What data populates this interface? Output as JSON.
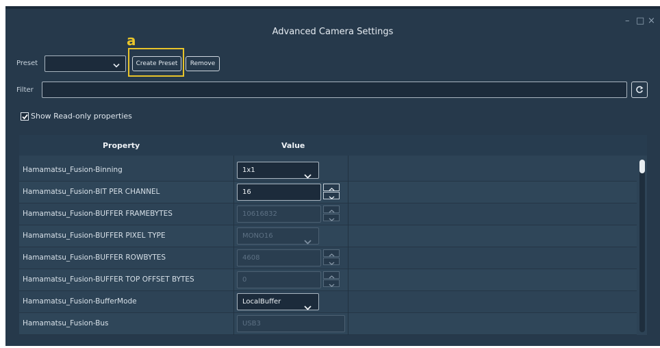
{
  "window": {
    "title": "Advanced Camera Settings",
    "controls": {
      "minimize": "–",
      "maximize": "□",
      "close": "×"
    }
  },
  "annotation": {
    "letter": "a",
    "color": "#e8c42a"
  },
  "preset": {
    "label": "Preset",
    "value": "",
    "create_label": "Create Preset",
    "remove_label": "Remove"
  },
  "filter": {
    "label": "Filter",
    "value": ""
  },
  "show_readonly": {
    "label": "Show Read-only properties",
    "checked": true
  },
  "table": {
    "headers": {
      "property": "Property",
      "value": "Value"
    },
    "rows": [
      {
        "property": "Hamamatsu_Fusion-Binning",
        "value": "1x1",
        "control": "dropdown",
        "disabled": false
      },
      {
        "property": "Hamamatsu_Fusion-BIT PER CHANNEL",
        "value": "16",
        "control": "spinner",
        "disabled": false
      },
      {
        "property": "Hamamatsu_Fusion-BUFFER FRAMEBYTES",
        "value": "10616832",
        "control": "spinner",
        "disabled": true
      },
      {
        "property": "Hamamatsu_Fusion-BUFFER PIXEL TYPE",
        "value": "MONO16",
        "control": "dropdown",
        "disabled": true
      },
      {
        "property": "Hamamatsu_Fusion-BUFFER ROWBYTES",
        "value": "4608",
        "control": "spinner",
        "disabled": true
      },
      {
        "property": "Hamamatsu_Fusion-BUFFER TOP OFFSET BYTES",
        "value": "0",
        "control": "spinner",
        "disabled": true
      },
      {
        "property": "Hamamatsu_Fusion-BufferMode",
        "value": "LocalBuffer",
        "control": "dropdown",
        "disabled": false
      },
      {
        "property": "Hamamatsu_Fusion-Bus",
        "value": "USB3",
        "control": "text",
        "disabled": true
      }
    ]
  },
  "icons": {
    "dropdown": "chevron-down-icon",
    "spin_up": "chevron-up-icon",
    "spin_down": "chevron-down-icon",
    "refresh": "refresh-icon",
    "checkbox": "checkmark-icon"
  },
  "colors": {
    "background": "#26394b",
    "table_background": "#2d4356",
    "text": "#dfe6ec",
    "annotation": "#e8c42a"
  }
}
